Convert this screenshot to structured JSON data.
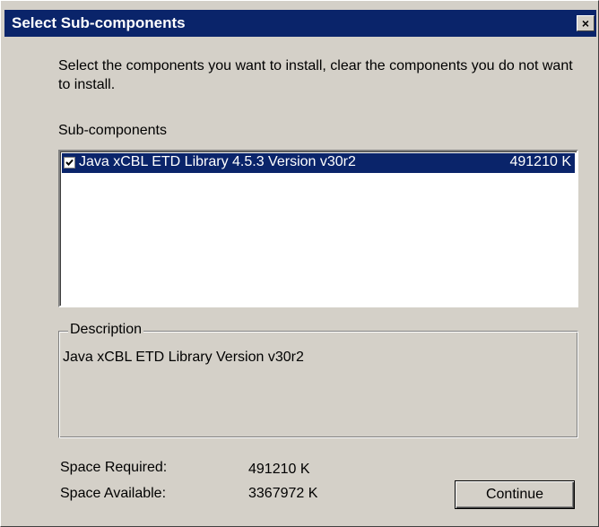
{
  "window": {
    "title": "Select Sub-components",
    "close_label": "×"
  },
  "instructions": "Select the components you want to install, clear the components you do not want to install.",
  "subcomponents": {
    "label": "Sub-components",
    "items": [
      {
        "name": "Java xCBL ETD Library 4.5.3 Version v30r2",
        "size": "491210 K",
        "checked": true,
        "selected": true
      }
    ]
  },
  "description": {
    "label": "Description",
    "text": "Java xCBL ETD Library Version v30r2"
  },
  "space": {
    "required_label": "Space Required:",
    "required_value": "491210 K",
    "available_label": "Space Available:",
    "available_value": "3367972 K"
  },
  "buttons": {
    "continue_label": "Continue"
  },
  "colors": {
    "titlebar": "#0a246a",
    "dialog_face": "#d4d0c8",
    "selection": "#0a246a"
  }
}
